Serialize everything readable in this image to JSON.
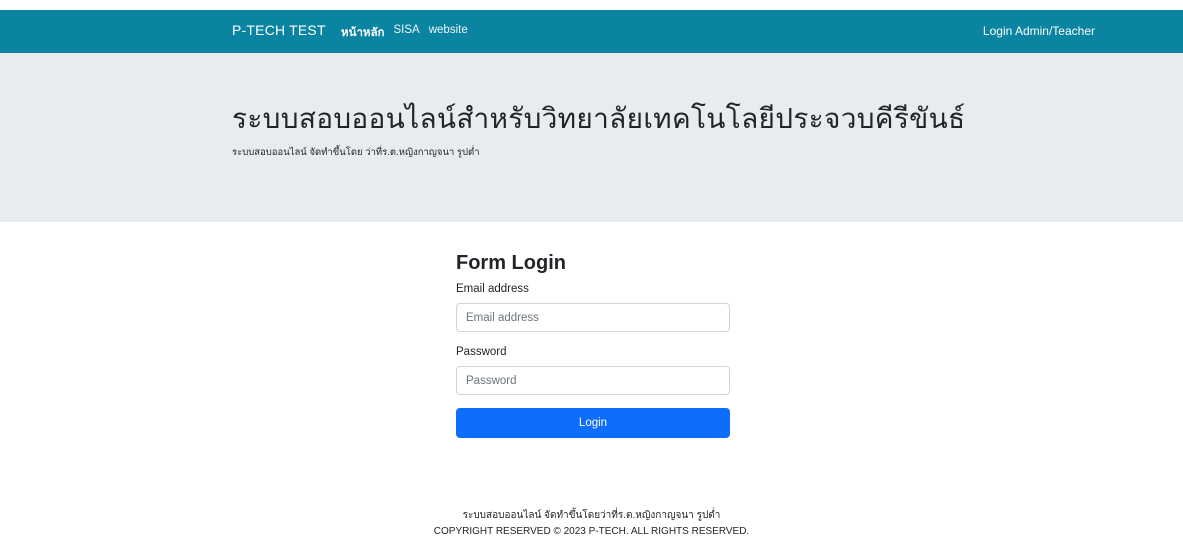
{
  "navbar": {
    "brand": "P-TECH TEST",
    "links": [
      {
        "label": "หน้าหลัก",
        "active": true
      },
      {
        "label": "SISA",
        "active": false
      },
      {
        "label": "website",
        "active": false
      }
    ],
    "right_link": "Login Admin/Teacher",
    "color": "#0a84a0"
  },
  "header": {
    "title": "ระบบสอบออนไลน์สำหรับวิทยาลัยเทคโนโลยีประจวบคีรีขันธ์",
    "subtitle": "ระบบสอบออนไลน์ จัดทำขึ้นโดย ว่าที่ร.ต.หญิงกาญจนา รูปต่ำ",
    "background": "#e9ecef"
  },
  "form": {
    "title": "Form Login",
    "email_label": "Email address",
    "email_placeholder": "Email address",
    "email_value": "",
    "password_label": "Password",
    "password_placeholder": "Password",
    "password_value": "",
    "submit_label": "Login",
    "submit_color": "#0d6efd"
  },
  "footer": {
    "line1": "ระบบสอบออนไลน์ จัดทำขึ้นโดยว่าที่ร.ต.หญิงกาญจนา รูปต่ำ",
    "line2": "COPYRIGHT RESERVED © 2023 P-TECH. ALL RIGHTS RESERVED."
  }
}
